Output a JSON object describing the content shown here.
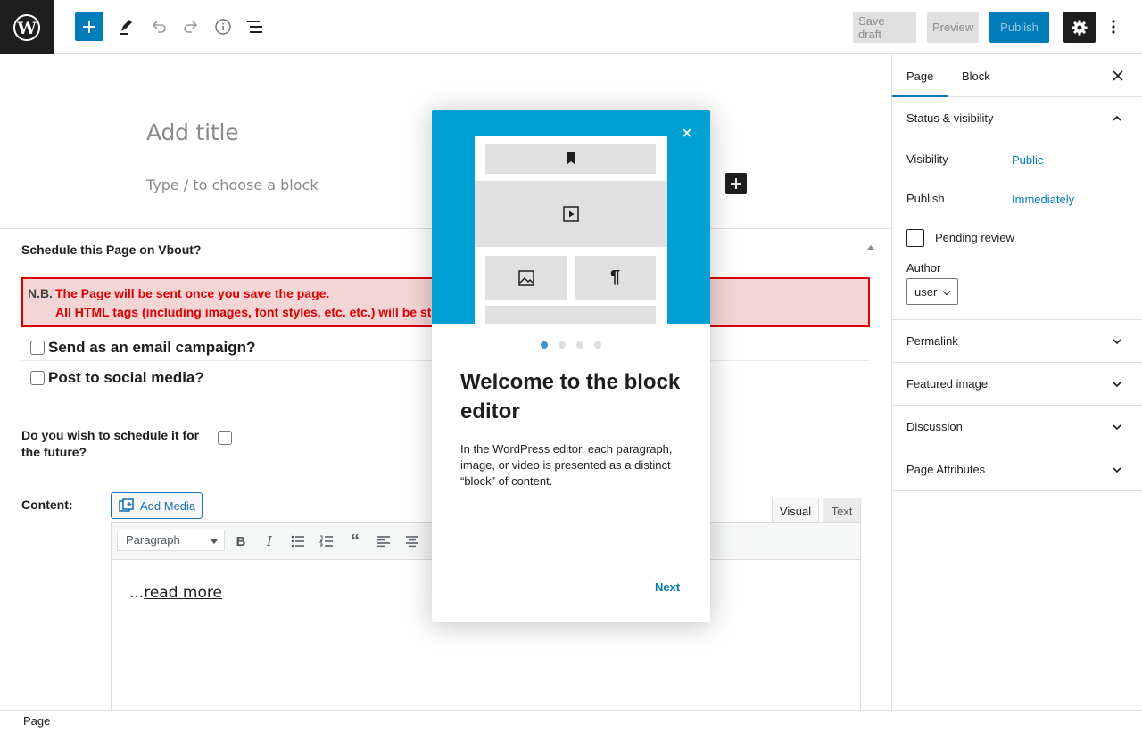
{
  "toolbar": {
    "save_draft": "Save draft",
    "preview": "Preview",
    "publish": "Publish"
  },
  "editor": {
    "title_placeholder": "Add title",
    "block_placeholder": "Type / to choose a block"
  },
  "metabox": {
    "title": "Schedule this Page on Vbout?",
    "notice_nb": "N.B.",
    "notice_line1": "The Page will be sent once you save the page.",
    "notice_line2": "All HTML tags (including images, font styles, etc. etc.) will be st",
    "email_campaign": "Send as an email campaign?",
    "social_media": "Post to social media?",
    "schedule_question": "Do you wish to schedule it for the future?",
    "content_label": "Content:",
    "add_media": "Add Media",
    "tab_visual": "Visual",
    "tab_text": "Text",
    "format_select": "Paragraph",
    "body_prefix": "...",
    "body_link": "read more"
  },
  "sidebar": {
    "tab_page": "Page",
    "tab_block": "Block",
    "status_title": "Status & visibility",
    "visibility_label": "Visibility",
    "visibility_value": "Public",
    "publish_label": "Publish",
    "publish_value": "Immediately",
    "pending_review": "Pending review",
    "author_label": "Author",
    "author_value": "user",
    "panels": [
      "Permalink",
      "Featured image",
      "Discussion",
      "Page Attributes"
    ]
  },
  "footer": {
    "breadcrumb": "Page"
  },
  "modal": {
    "heading": "Welcome to the block editor",
    "body": "In the WordPress editor, each paragraph, image, or video is presented as a distinct “block” of content.",
    "next": "Next",
    "current_page": 1,
    "page_count": 4
  },
  "colors": {
    "accent": "#007cba",
    "hero": "#00a0d2",
    "notice_border": "#dc0000",
    "notice_bg": "#f4d5d5"
  }
}
